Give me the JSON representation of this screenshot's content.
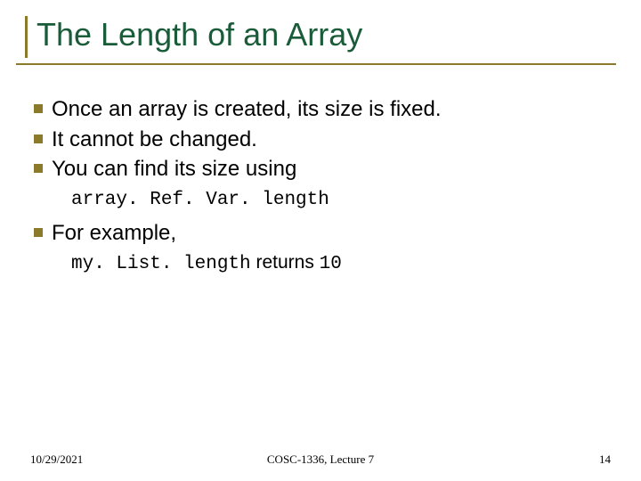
{
  "title": "The Length of an Array",
  "bullets": {
    "b0": "Once an array is created, its size is fixed.",
    "b1": "It cannot be changed.",
    "b2": "You can find its size using",
    "b3": "For example,"
  },
  "code": {
    "syntax": "array. Ref. Var. length"
  },
  "example": {
    "code": "my. List. length",
    "mid": " returns ",
    "value": "10"
  },
  "footer": {
    "date": "10/29/2021",
    "course": "COSC-1336, Lecture 7",
    "page": "14"
  }
}
